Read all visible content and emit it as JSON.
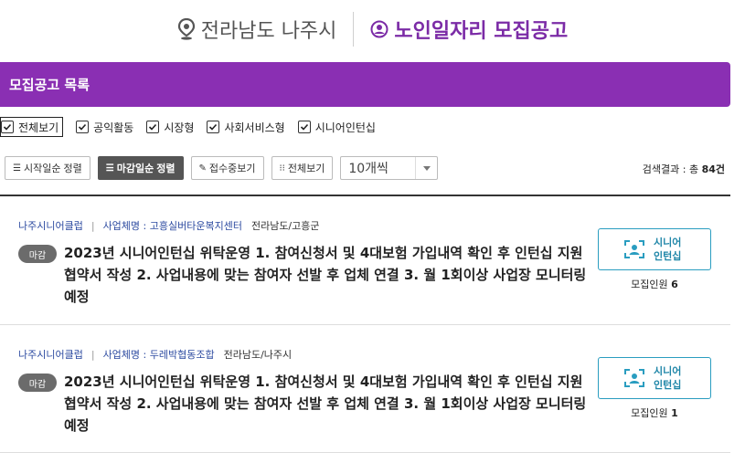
{
  "header": {
    "region": "전라남도 나주시",
    "title": "노인일자리 모집공고"
  },
  "list_bar": {
    "title": "모집공고 목록"
  },
  "filters": [
    {
      "label": "전체보기",
      "checked": true
    },
    {
      "label": "공익활동",
      "checked": true
    },
    {
      "label": "시장형",
      "checked": true
    },
    {
      "label": "사회서비스형",
      "checked": true
    },
    {
      "label": "시니어인턴십",
      "checked": true
    }
  ],
  "toolbar": {
    "sort_start": "시작일순 정렬",
    "sort_end": "마감일순 정렬",
    "receiving": "접수중보기",
    "view_all": "전체보기",
    "page_size": "10개씩"
  },
  "result": {
    "label": "검색결과 : 총 ",
    "count": "84건"
  },
  "cards": [
    {
      "org": "나주시니어클럽",
      "sep": "|",
      "biz": "사업체명 : 고흥실버타운복지센터",
      "area": "전라남도/고흥군",
      "badge": "마감",
      "title": "2023년 시니어인턴십 위탁운영 1. 참여신청서 및 4대보험 가입내역 확인 후 인턴십 지원협약서 작성 2. 사업내용에 맞는 참여자 선발 후 업체 연결 3. 월 1회이상 사업장 모니터링 예정",
      "tag_line1": "시니어",
      "tag_line2": "인턴십",
      "recruit_label": "모집인원 ",
      "recruit_count": "6"
    },
    {
      "org": "나주시니어클럽",
      "sep": "|",
      "biz": "사업체명 : 두레박협동조합",
      "area": "전라남도/나주시",
      "badge": "마감",
      "title": "2023년 시니어인턴십 위탁운영 1. 참여신청서 및 4대보험 가입내역 확인 후 인턴십 지원협약서 작성 2. 사업내용에 맞는 참여자 선발 후 업체 연결 3. 월 1회이상 사업장 모니터링 예정",
      "tag_line1": "시니어",
      "tag_line2": "인턴십",
      "recruit_label": "모집인원 ",
      "recruit_count": "1"
    }
  ],
  "colors": {
    "accent": "#8a2fb3",
    "title_purple": "#7b2ba6",
    "link_blue": "#2c4aa0",
    "tag_blue": "#2a9dc0"
  }
}
